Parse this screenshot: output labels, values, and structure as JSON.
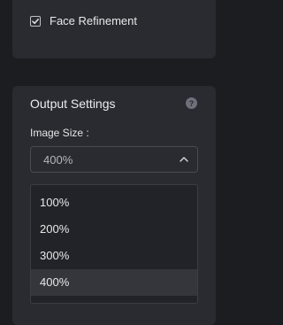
{
  "face_refinement": {
    "label": "Face Refinement",
    "checked": true
  },
  "output_settings": {
    "title": "Output Settings",
    "help_glyph": "?",
    "image_size_label": "Image Size :",
    "image_size_value": "400%",
    "options": [
      {
        "label": "100%"
      },
      {
        "label": "200%"
      },
      {
        "label": "300%"
      },
      {
        "label": "400%",
        "selected": true
      }
    ]
  }
}
